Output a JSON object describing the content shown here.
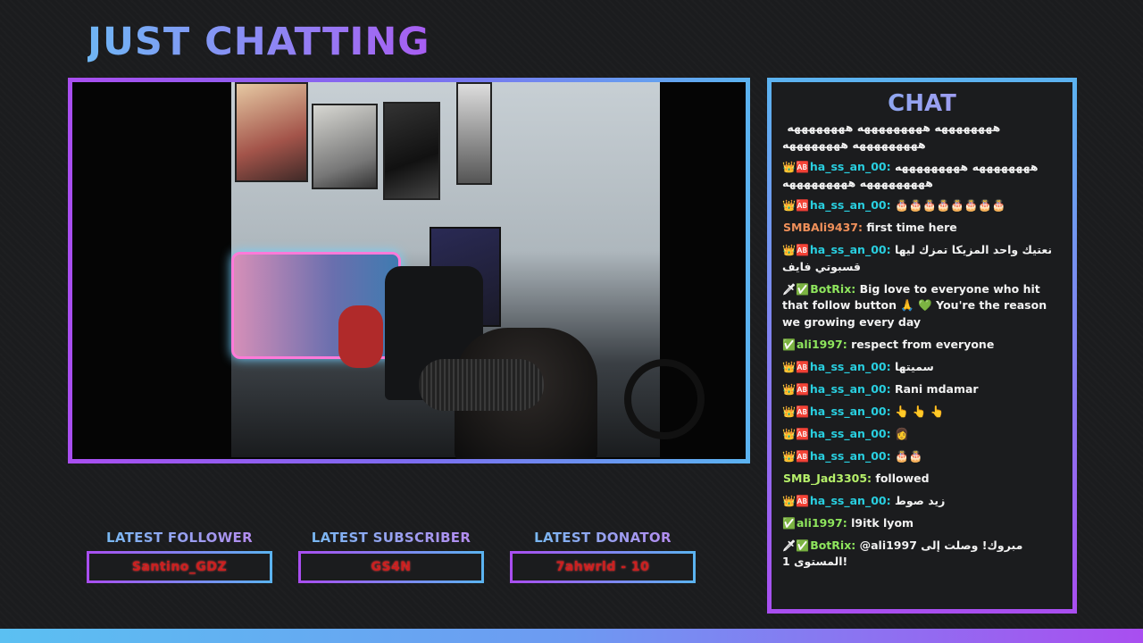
{
  "page_title": "JUST CHATTING",
  "colors": {
    "accent_blue": "#5bb3f0",
    "accent_purple": "#a94ef0",
    "stat_value_red": "#cc1f1f"
  },
  "stats": [
    {
      "label": "LATEST FOLLOWER",
      "value": "Santino_GDZ"
    },
    {
      "label": "LATEST SUBSCRIBER",
      "value": "GS4N"
    },
    {
      "label": "LATEST DONATOR",
      "value": "7ahwrld - 10"
    }
  ],
  "chat": {
    "title": "CHAT",
    "messages": [
      {
        "badges": "",
        "user": "",
        "text": "ههههههههه هههههههههه ههههههههه هههههههههه ههههههههه",
        "color": "u-cyan"
      },
      {
        "badges": "👑🆎",
        "user": "ha_ss_an_00:",
        "text": "ههههههههه هههههههههه هههههههههه هههههههههه",
        "color": "u-cyan"
      },
      {
        "badges": "👑🆎",
        "user": "ha_ss_an_00:",
        "text": "🎂🎂🎂🎂🎂🎂🎂🎂",
        "color": "u-cyan"
      },
      {
        "badges": "",
        "user": "SMBAli9437:",
        "text": "first time here",
        "color": "u-orange"
      },
      {
        "badges": "👑🆎",
        "user": "ha_ss_an_00:",
        "text": "نعتيك واحد المزيكا تمزك ليها قسبوتي فايف",
        "color": "u-cyan"
      },
      {
        "badges": "🗡✅",
        "user": "BotRix:",
        "text": "Big love to everyone who hit that follow button 🙏 💚 You're the reason we growing every day",
        "color": "u-green"
      },
      {
        "badges": "✅",
        "user": "ali1997:",
        "text": "respect from everyone",
        "color": "u-green"
      },
      {
        "badges": "👑🆎",
        "user": "ha_ss_an_00:",
        "text": "سميتها",
        "color": "u-cyan"
      },
      {
        "badges": "👑🆎",
        "user": "ha_ss_an_00:",
        "text": "Rani mdamar",
        "color": "u-cyan"
      },
      {
        "badges": "👑🆎",
        "user": "ha_ss_an_00:",
        "text": "👆 👆 👆",
        "color": "u-cyan"
      },
      {
        "badges": "👑🆎",
        "user": "ha_ss_an_00:",
        "text": "👩",
        "color": "u-cyan"
      },
      {
        "badges": "👑🆎",
        "user": "ha_ss_an_00:",
        "text": "🎂🎂",
        "color": "u-cyan"
      },
      {
        "badges": "",
        "user": "SMB_Jad3305:",
        "text": "followed",
        "color": "u-mint"
      },
      {
        "badges": "👑🆎",
        "user": "ha_ss_an_00:",
        "text": "زيد صوط",
        "color": "u-cyan"
      },
      {
        "badges": "✅",
        "user": "ali1997:",
        "text": "l9itk lyom",
        "color": "u-green"
      },
      {
        "badges": "🗡✅",
        "user": "BotRix:",
        "text": "@ali1997 مبروك! وصلت إلى المستوى 1!",
        "color": "u-green"
      }
    ]
  }
}
